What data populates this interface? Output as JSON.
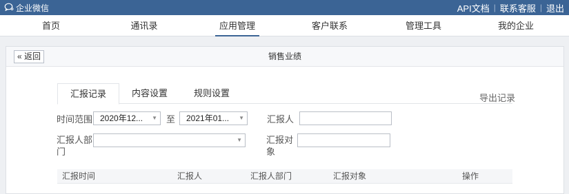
{
  "topbar": {
    "brand": "企业微信",
    "links": [
      "API文档",
      "联系客服",
      "退出"
    ]
  },
  "nav": {
    "items": [
      "首页",
      "通讯录",
      "应用管理",
      "客户联系",
      "管理工具",
      "我的企业"
    ],
    "active_index": 2
  },
  "panel": {
    "back_label": "« 返回",
    "title": "销售业绩"
  },
  "tabs": {
    "items": [
      "汇报记录",
      "内容设置",
      "规则设置"
    ],
    "active_index": 0,
    "export_label": "导出记录"
  },
  "filters": {
    "time_range_label": "时间范围",
    "start_value": "2020年12...",
    "to_label": "至",
    "end_value": "2021年01...",
    "reporter_label": "汇报人",
    "reporter_value": "",
    "dept_label_line1": "汇报人部",
    "dept_label_line2": "门",
    "dept_value": "",
    "target_label_line1": "汇报对",
    "target_label_line2": "象",
    "target_value": ""
  },
  "table": {
    "headers": [
      "汇报时间",
      "汇报人",
      "汇报人部门",
      "汇报对象",
      "操作"
    ]
  },
  "colors": {
    "topbar": "#3b6495",
    "accent": "#3b6495"
  }
}
